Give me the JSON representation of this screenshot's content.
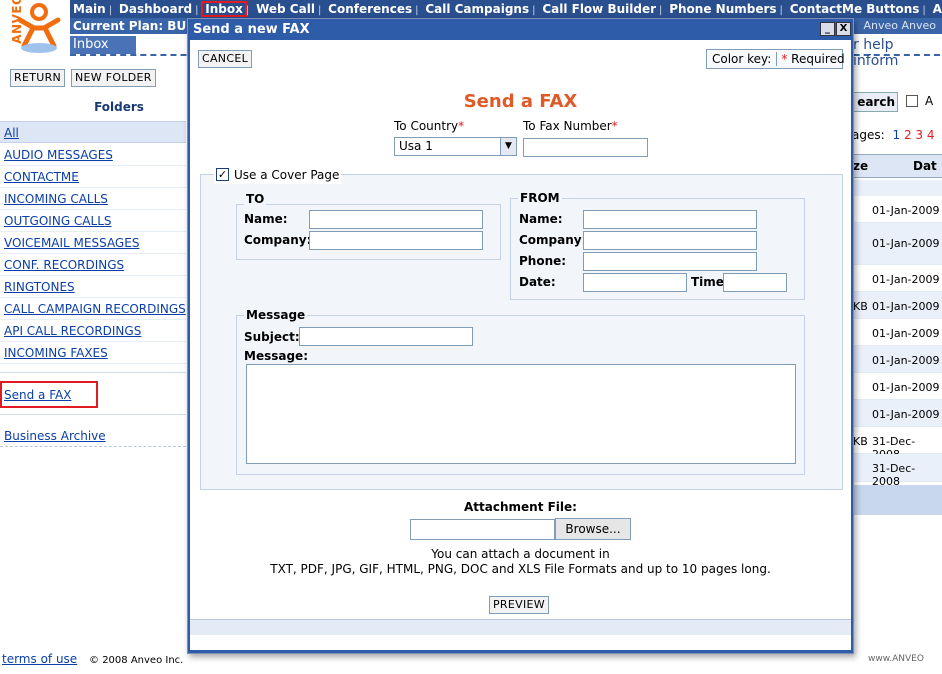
{
  "logo": {
    "text": "ANVEO"
  },
  "nav": {
    "items": [
      "Main",
      "Dashboard",
      "Inbox",
      "Web Call",
      "Conferences",
      "Call Campaigns",
      "Call Flow Builder",
      "Phone Numbers",
      "ContactMe Buttons",
      "Anve"
    ],
    "active": "Inbox",
    "separator": "|"
  },
  "plan": {
    "label": "Current Plan: BUS",
    "right_text": "Anveo Anveo",
    "right_link": "r help inform"
  },
  "inbox_tab": "Inbox",
  "left": {
    "return_label": "RETURN",
    "new_folder_label": "NEW FOLDER",
    "folders_title": "Folders",
    "folders": [
      "All",
      "AUDIO MESSAGES",
      "CONTACTME",
      "INCOMING CALLS",
      "OUTGOING CALLS",
      "VOICEMAIL MESSAGES",
      "CONF. RECORDINGS",
      "RINGTONES",
      "CALL CAMPAIGN RECORDINGS",
      "API CALL RECORDINGS",
      "INCOMING FAXES"
    ],
    "send_fax": "Send a FAX",
    "business_archive": "Business Archive",
    "terms": "terms of use",
    "copyright": "© 2008 Anveo Inc."
  },
  "right": {
    "search": "earch",
    "checkbox_label": "A",
    "pages_label": "ages:",
    "pages": [
      "1",
      "2",
      "3",
      "4"
    ],
    "col_size": "ze",
    "col_date": "Dat",
    "rows": [
      {
        "size": "",
        "date": "01-Jan-2009"
      },
      {
        "size": "",
        "date": "01-Jan-2009"
      },
      {
        "size": "",
        "date": "01-Jan-2009"
      },
      {
        "size": "KB",
        "date": "01-Jan-2009"
      },
      {
        "size": "",
        "date": "01-Jan-2009"
      },
      {
        "size": "",
        "date": "01-Jan-2009"
      },
      {
        "size": "",
        "date": "01-Jan-2009"
      },
      {
        "size": "",
        "date": "01-Jan-2009"
      },
      {
        "size": "KB",
        "date": "31-Dec-2008"
      },
      {
        "size": "",
        "date": "31-Dec-2008"
      }
    ],
    "footer_right": "www.ANVEO"
  },
  "modal": {
    "title": "Send a new FAX",
    "min_btn": "_",
    "close_btn": "X",
    "cancel_label": "CANCEL",
    "color_key_label": "Color key:",
    "required_star": "*",
    "required_label": "Required",
    "heading": "Send a FAX",
    "to_country_label": "To Country",
    "to_country_value": "Usa 1",
    "to_fax_label": "To Fax Number",
    "to_fax_value": "",
    "cover_label": "Use a Cover Page",
    "cover_checked": true,
    "to_section": {
      "legend": "TO",
      "name_label": "Name:",
      "company_label": "Company:"
    },
    "from_section": {
      "legend": "FROM",
      "name_label": "Name:",
      "company_label": "Company:",
      "phone_label": "Phone:",
      "date_label": "Date:",
      "time_label": "Time:"
    },
    "message_section": {
      "legend": "Message",
      "subject_label": "Subject:",
      "message_label": "Message:"
    },
    "attachment_label": "Attachment File:",
    "browse_label": "Browse...",
    "attach_note_1": "You can attach a document in",
    "attach_note_2": "TXT, PDF, JPG, GIF, HTML, PNG, DOC and XLS File Formats and up to 10 pages long.",
    "preview_label": "PREVIEW"
  },
  "colors": {
    "nav_bg": "#2a4f8f",
    "modal_title_bg": "#2f5ca8",
    "heading": "#e05a28",
    "required": "#e01b22",
    "highlight_box": "#e01b22"
  }
}
